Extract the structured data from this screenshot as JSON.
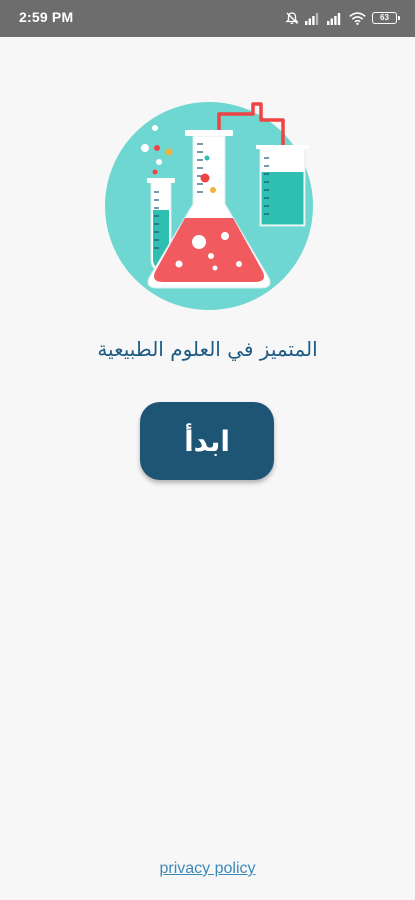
{
  "status_bar": {
    "time": "2:59 PM",
    "battery_level": "63",
    "icons": [
      "muted-alarm-icon",
      "signal-icon",
      "signal-icon",
      "wifi-icon",
      "battery-icon"
    ]
  },
  "main": {
    "title": "المتميز في العلوم الطبيعية",
    "start_button_label": "ابدأ",
    "illustration": "lab-flasks-icon"
  },
  "footer": {
    "privacy_link": "privacy policy"
  },
  "colors": {
    "status_bar": "#6d6d6d",
    "background": "#f7f7f8",
    "title": "#1d5b84",
    "button": "#1e5575",
    "circle": "#6fd7d1",
    "liquid_red": "#f15a5f",
    "liquid_teal": "#2fbfb1",
    "tube_red": "#ee4444",
    "link": "#3d8ab8"
  }
}
